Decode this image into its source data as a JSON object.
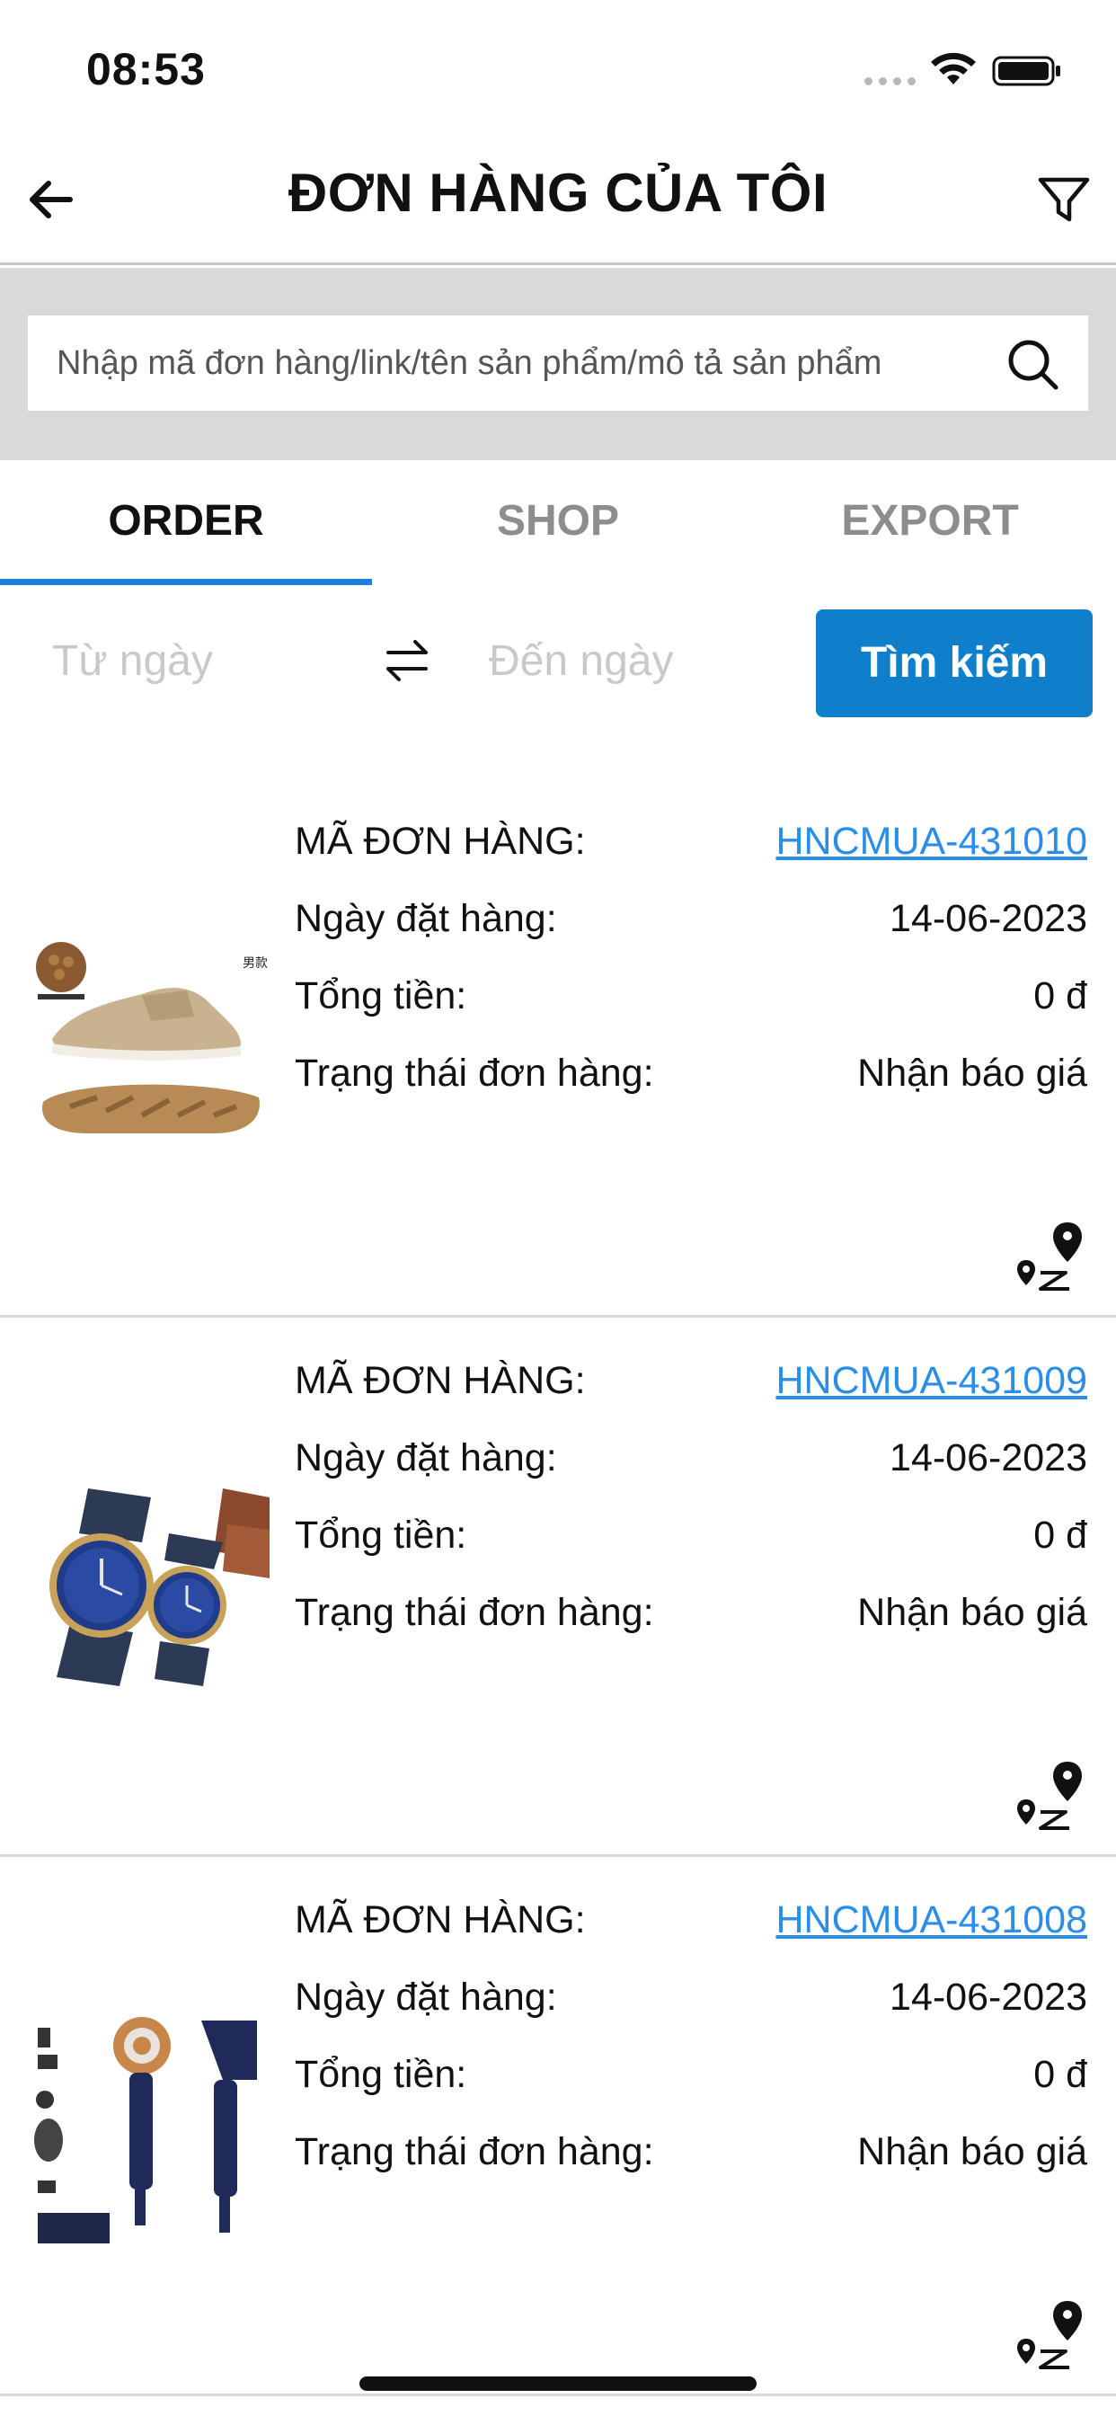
{
  "status_bar": {
    "time": "08:53",
    "icons": [
      "signal-dots-icon",
      "wifi-icon",
      "battery-icon"
    ]
  },
  "header": {
    "title": "ĐƠN HÀNG CỦA TÔI",
    "back_icon": "arrow-left-icon",
    "filter_icon": "funnel-icon"
  },
  "search": {
    "placeholder": "Nhập mã đơn hàng/link/tên sản phẩm/mô tả sản phẩm",
    "value": "",
    "icon": "search-icon"
  },
  "tabs": [
    {
      "label": "ORDER",
      "active": true
    },
    {
      "label": "SHOP",
      "active": false
    },
    {
      "label": "EXPORT",
      "active": false
    }
  ],
  "date_filter": {
    "from_placeholder": "Từ ngày",
    "to_placeholder": "Đến ngày",
    "swap_icon": "swap-arrows-icon",
    "search_button": "Tìm kiếm"
  },
  "labels": {
    "order_code": "MÃ ĐƠN HÀNG:",
    "order_date": "Ngày đặt hàng:",
    "total": "Tổng tiền:",
    "status": "Trạng thái đơn hàng:"
  },
  "orders": [
    {
      "code": "HNCMUA-431010",
      "date": "14-06-2023",
      "total": "0 đ",
      "status": "Nhận báo giá",
      "thumbnail": "hiking-shoe",
      "thumbnail_text": "男款"
    },
    {
      "code": "HNCMUA-431009",
      "date": "14-06-2023",
      "total": "0 đ",
      "status": "Nhận báo giá",
      "thumbnail": "couple-watches"
    },
    {
      "code": "HNCMUA-431008",
      "date": "14-06-2023",
      "total": "0 đ",
      "status": "Nhận báo giá",
      "thumbnail": "hair-dryer-set"
    }
  ],
  "colors": {
    "accent": "#1f7fe0",
    "button": "#0f7fcb",
    "link": "#2a8ee8",
    "search_bg": "#d9d9d9"
  }
}
